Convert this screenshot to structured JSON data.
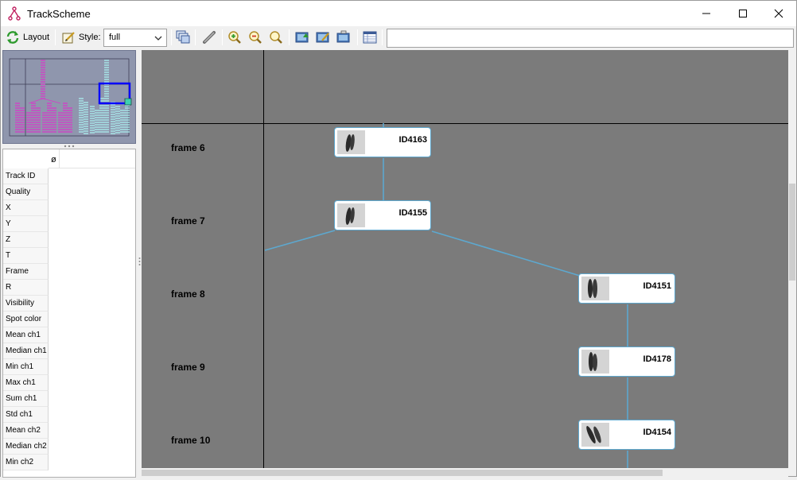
{
  "window": {
    "title": "TrackScheme"
  },
  "toolbar": {
    "layout_label": "Layout",
    "style_label": "Style:",
    "style_value": "full",
    "search_value": ""
  },
  "feature_table": {
    "column_header": "ø",
    "rows": [
      "Track ID",
      "Quality",
      "X",
      "Y",
      "Z",
      "T",
      "Frame",
      "R",
      "Visibility",
      "Spot color",
      "Mean ch1",
      "Median ch1",
      "Min ch1",
      "Max ch1",
      "Sum ch1",
      "Std ch1",
      "Mean ch2",
      "Median ch2",
      "Min ch2"
    ]
  },
  "frames": [
    {
      "label": "frame 6"
    },
    {
      "label": "frame 7"
    },
    {
      "label": "frame 8"
    },
    {
      "label": "frame 9"
    },
    {
      "label": "frame 10"
    }
  ],
  "spots": [
    {
      "id": "ID4163"
    },
    {
      "id": "ID4155"
    },
    {
      "id": "ID4151"
    },
    {
      "id": "ID4178"
    },
    {
      "id": "ID4154"
    }
  ],
  "colors": {
    "canvas_bg": "#7b7b7b",
    "edge": "#5da8cf",
    "minimap_bg": "#8f96ad",
    "track_magenta": "#d63bc9",
    "track_cyan": "#a9f0f0",
    "viewport": "#0000ff"
  }
}
